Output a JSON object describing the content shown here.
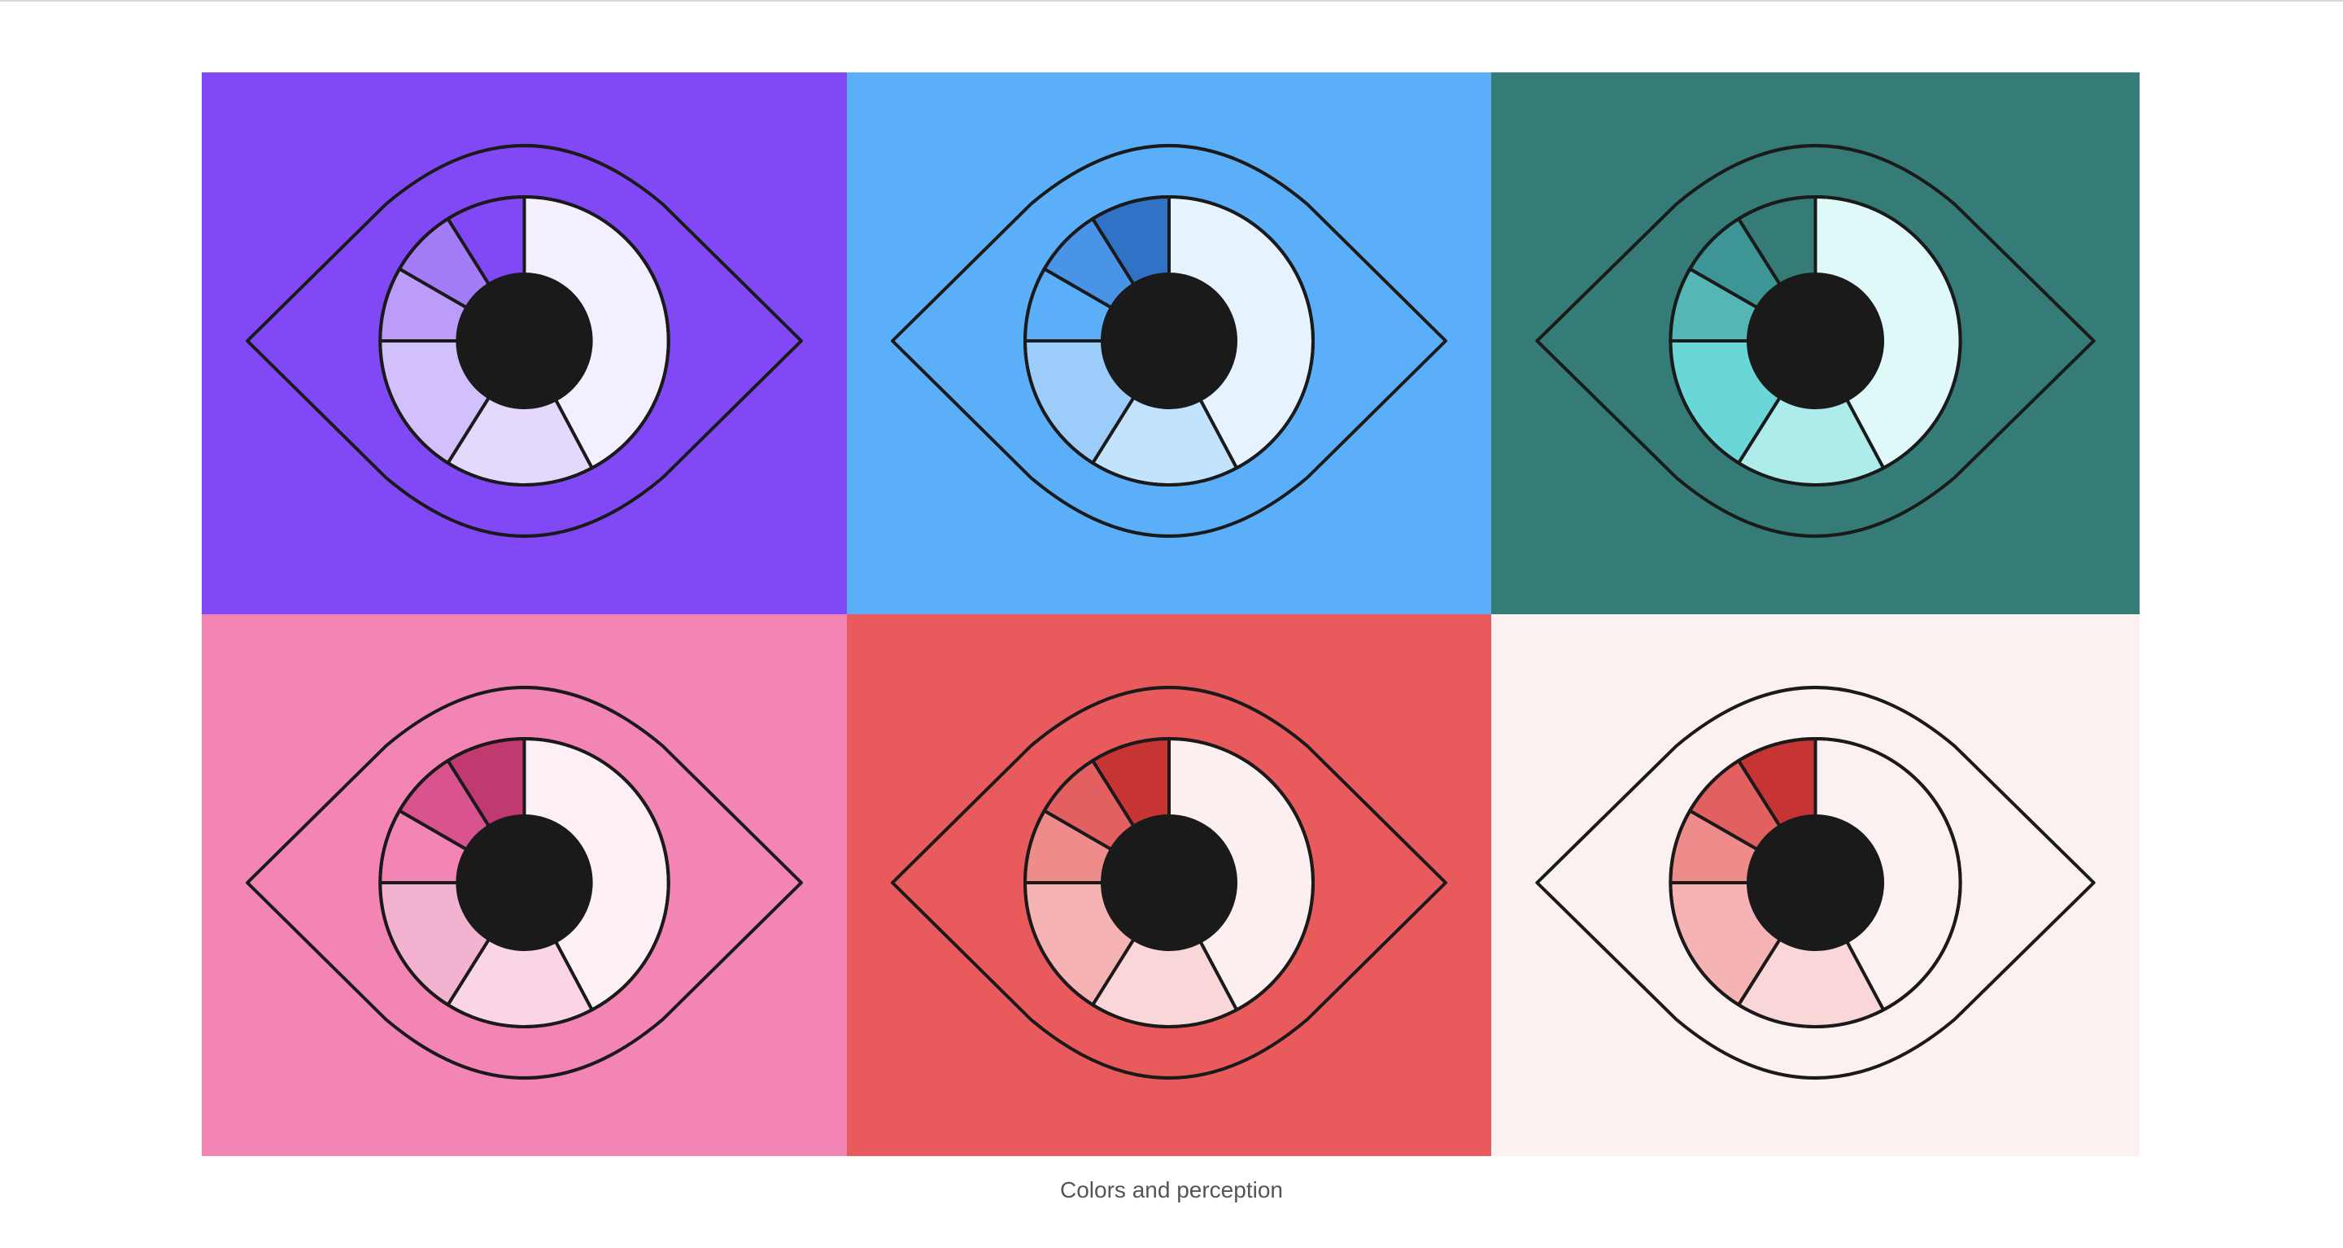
{
  "caption": "Colors and perception",
  "illustration": {
    "subject": "eye-icon",
    "stroke_color": "#1a1a1a",
    "pupil_color": "#1a1a1a",
    "tiles": [
      {
        "id": "purple",
        "background": "#8149f5",
        "segments": [
          "#f3effe",
          "#e5d8fd",
          "#d2c0fc",
          "#bb9cf9",
          "#a47cf7",
          "#8149f5"
        ]
      },
      {
        "id": "blue",
        "background": "#5aaff8",
        "segments": [
          "#e6f3fe",
          "#c3e2fc",
          "#9ccdfa",
          "#5aaff8",
          "#4a94e8",
          "#2f72c6"
        ]
      },
      {
        "id": "teal",
        "background": "#357c78",
        "segments": [
          "#dff9f8",
          "#aeecec",
          "#6bd6d7",
          "#55b6b6",
          "#3e9595",
          "#357c78"
        ]
      },
      {
        "id": "pink",
        "background": "#f285b4",
        "segments": [
          "#fcf0f6",
          "#f9d5e5",
          "#f4b2d1",
          "#f285b4",
          "#d9538f",
          "#c03a70"
        ]
      },
      {
        "id": "red",
        "background": "#e85a5b",
        "segments": [
          "#fcefef",
          "#f9d6d7",
          "#f5b3b4",
          "#ee8b8b",
          "#e26060",
          "#c73434"
        ]
      },
      {
        "id": "blush",
        "background": "#fcf1f1",
        "segments": [
          "#fcf1f1",
          "#f9d6d7",
          "#f5b3b4",
          "#ee8b8b",
          "#e26060",
          "#c73434"
        ]
      }
    ]
  }
}
